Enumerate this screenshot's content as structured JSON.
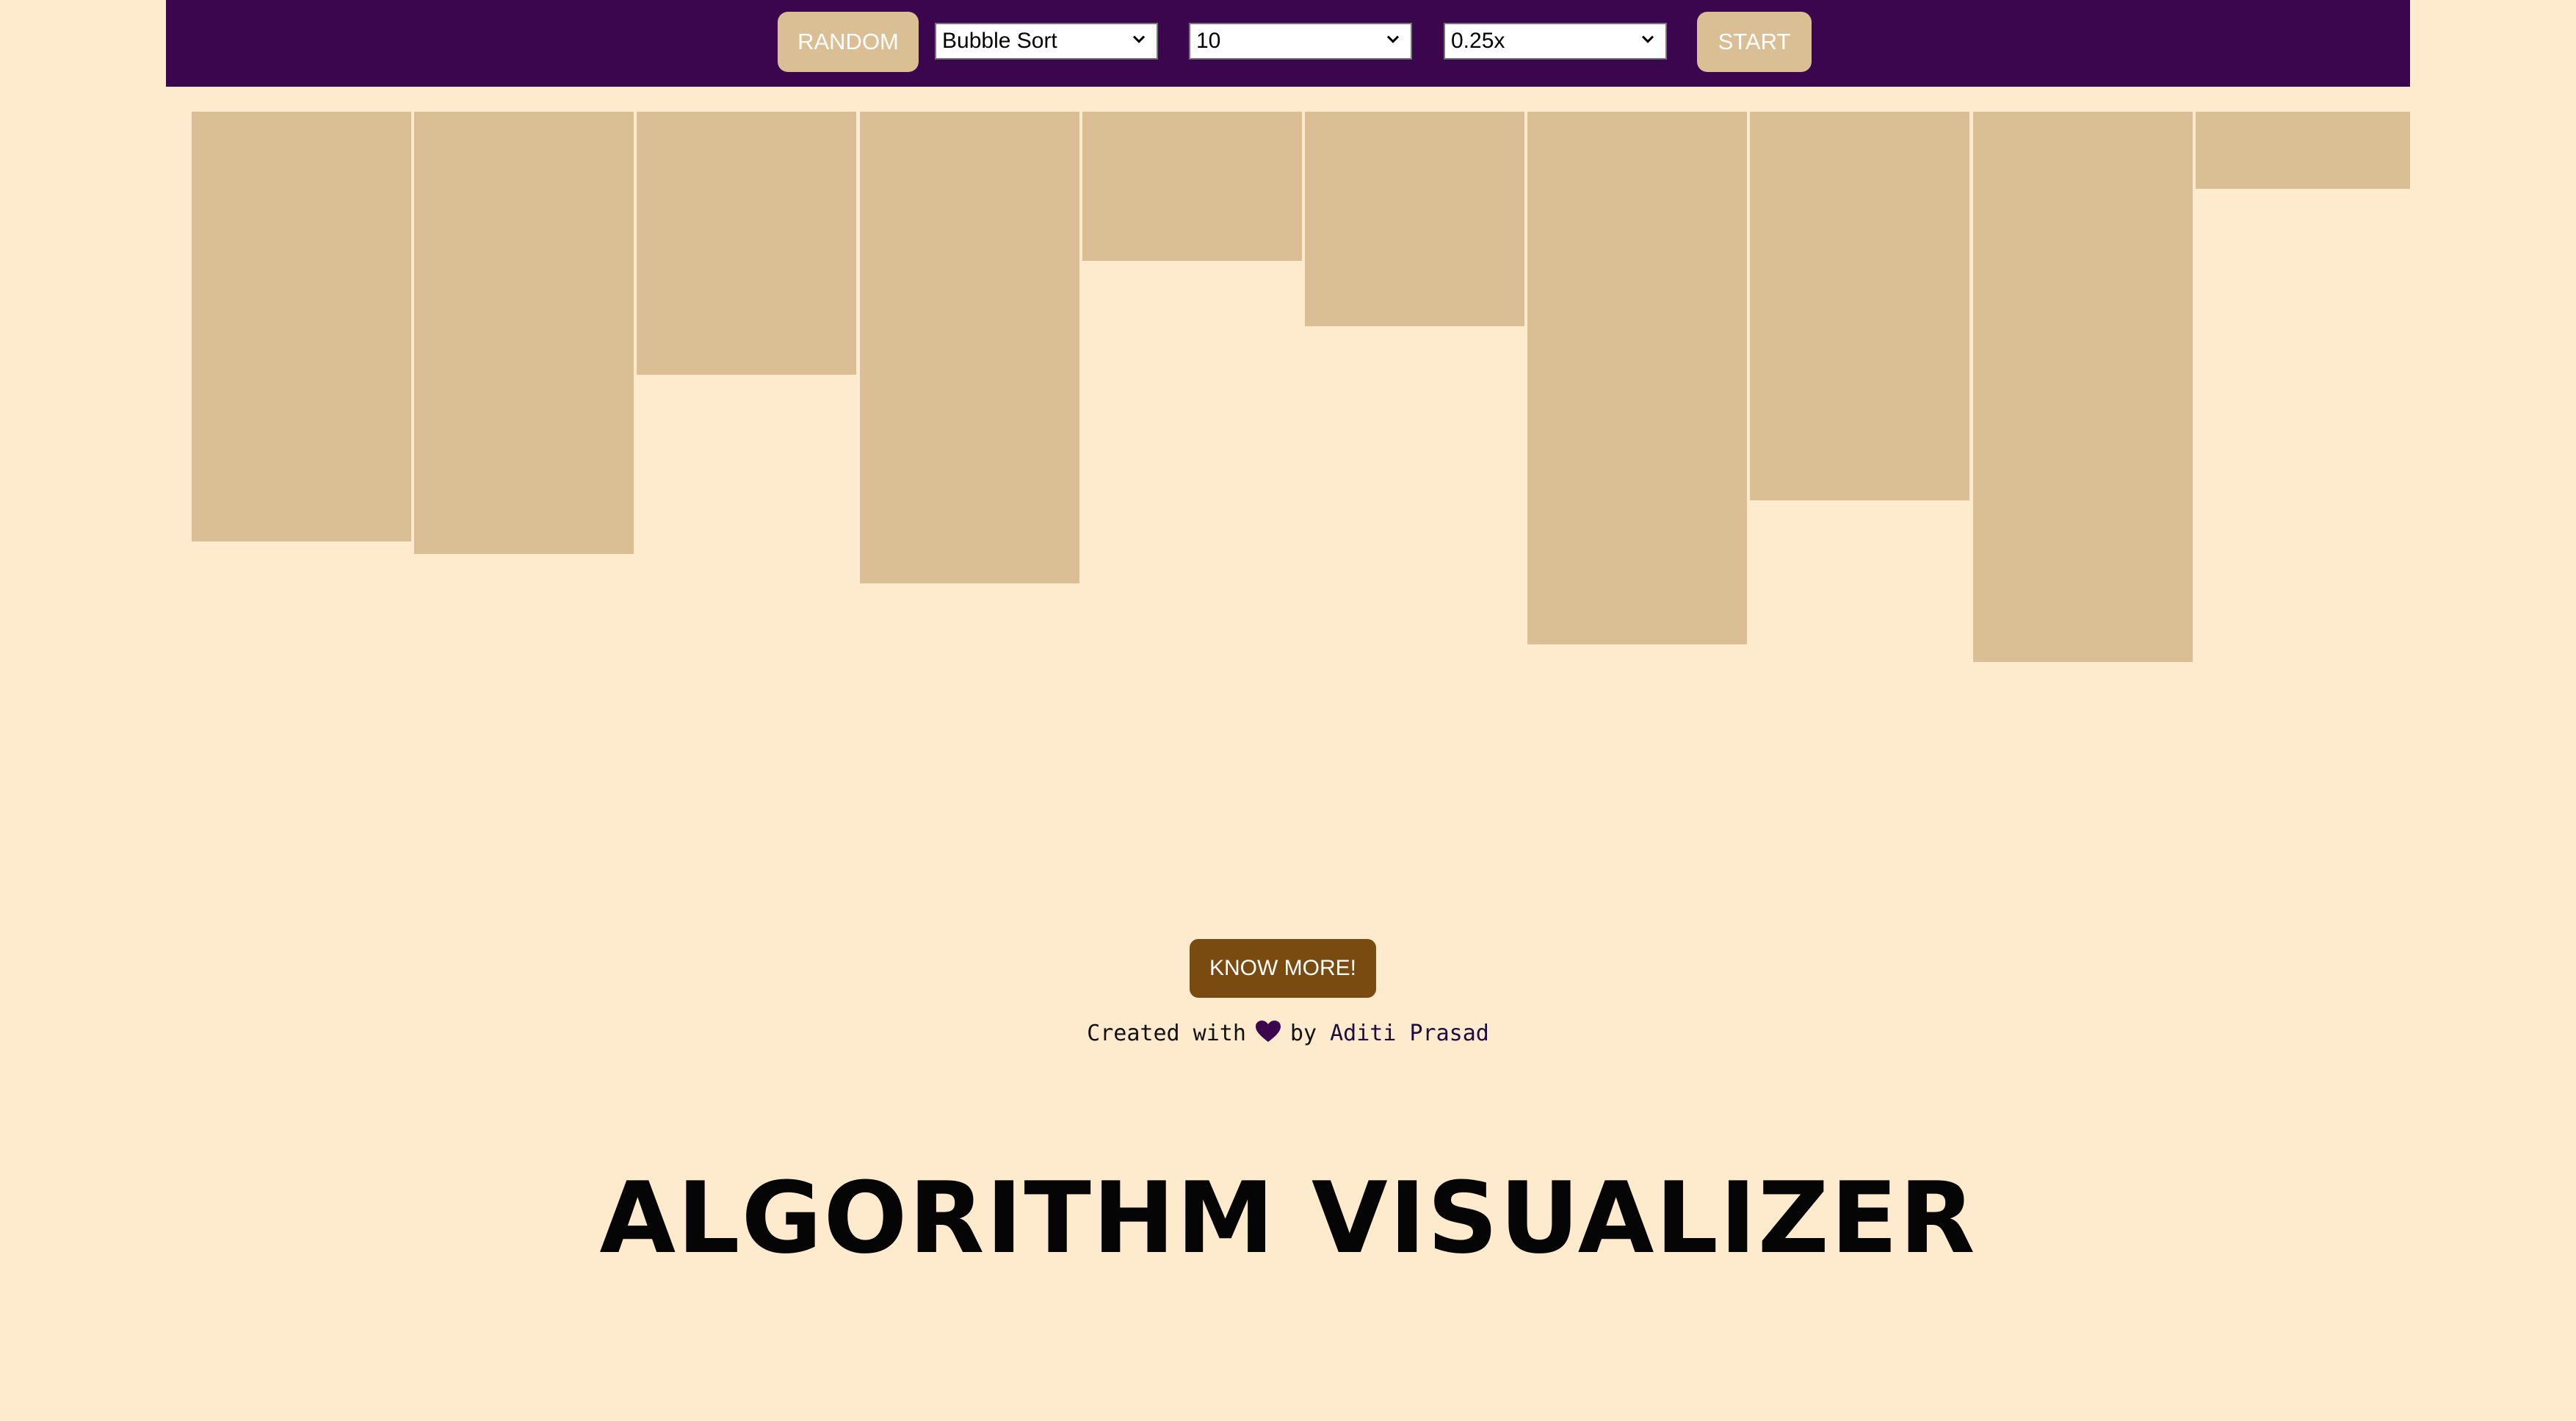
{
  "navbar": {
    "random_label": "RANDOM",
    "algorithm_selected": "Bubble Sort",
    "size_selected": "10",
    "speed_selected": "0.25x",
    "start_label": "START"
  },
  "array": {
    "values": [
      585,
      602,
      358,
      642,
      203,
      292,
      725,
      529,
      749,
      105
    ]
  },
  "know_more_label": "KNOW MORE!",
  "footer": {
    "created_text": "Created with",
    "by_text": "by",
    "author": "Aditi Prasad"
  },
  "title": "ALGORITHM VISUALIZER",
  "colors": {
    "background": "#feebcd",
    "navbar": "#3b064d",
    "bar": "#dabe94",
    "know_more": "#7a4b10"
  }
}
